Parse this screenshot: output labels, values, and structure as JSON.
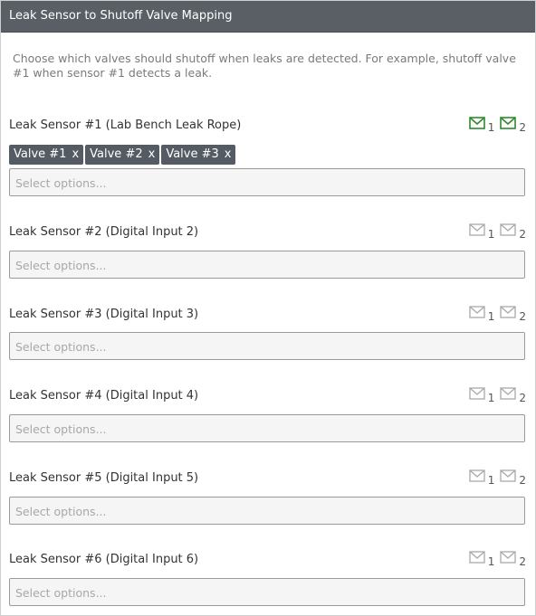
{
  "panel": {
    "title": "Leak Sensor to Shutoff Valve Mapping",
    "description": "Choose which valves should shutoff when leaks are detected. For example, shutoff valve #1 when sensor #1 detects a leak."
  },
  "colors": {
    "active_icon": "#2e8b2e",
    "inactive_icon": "#a9a9a9",
    "header_bg": "#5a5f66",
    "tag_bg": "#555b63"
  },
  "select_placeholder": "Select options...",
  "sensors": [
    {
      "label": "Leak Sensor #1 (Lab Bench Leak Rope)",
      "notify1": "1",
      "notify2": "2",
      "active": true,
      "tags": [
        "Valve #1",
        "Valve #2",
        "Valve #3"
      ]
    },
    {
      "label": "Leak Sensor #2 (Digital Input 2)",
      "notify1": "1",
      "notify2": "2",
      "active": false,
      "tags": []
    },
    {
      "label": "Leak Sensor #3 (Digital Input 3)",
      "notify1": "1",
      "notify2": "2",
      "active": false,
      "tags": []
    },
    {
      "label": "Leak Sensor #4 (Digital Input 4)",
      "notify1": "1",
      "notify2": "2",
      "active": false,
      "tags": []
    },
    {
      "label": "Leak Sensor #5 (Digital Input 5)",
      "notify1": "1",
      "notify2": "2",
      "active": false,
      "tags": []
    },
    {
      "label": "Leak Sensor #6 (Digital Input 6)",
      "notify1": "1",
      "notify2": "2",
      "active": false,
      "tags": []
    }
  ],
  "tag_remove_glyph": "x"
}
